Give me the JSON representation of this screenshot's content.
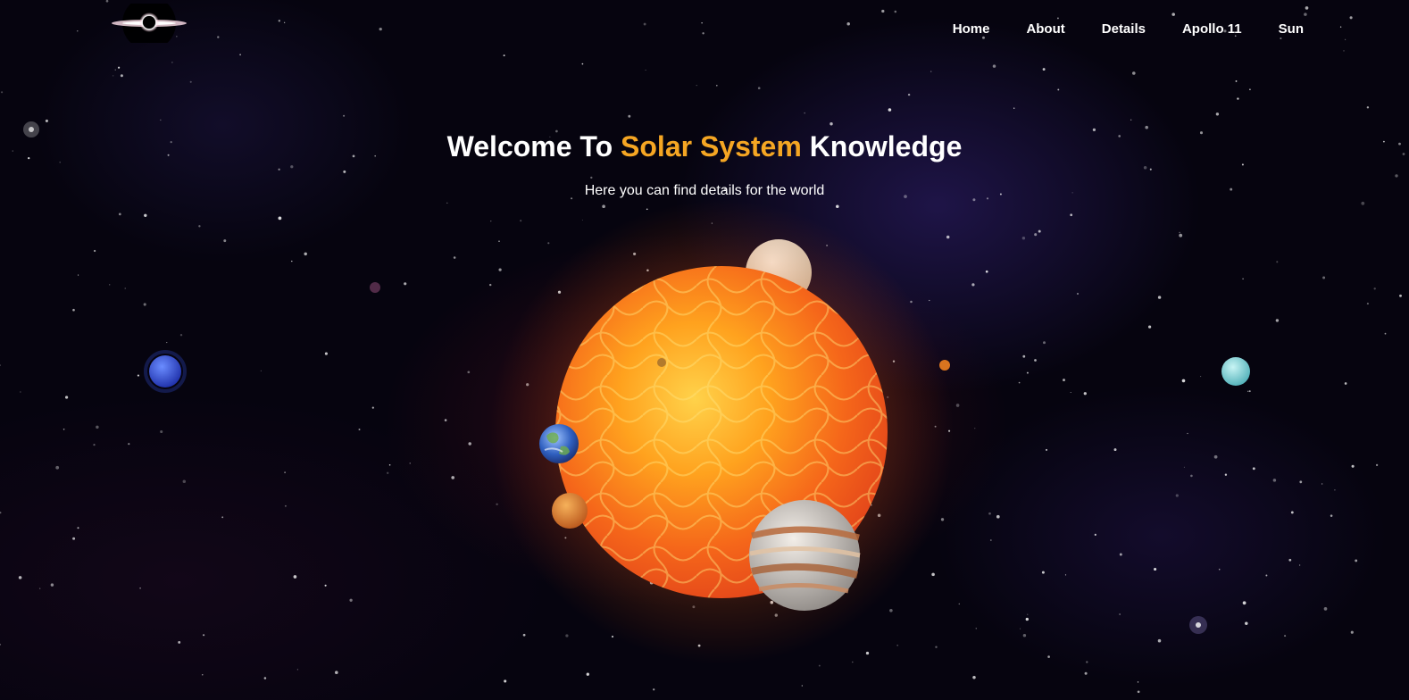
{
  "nav": {
    "logo_icon": "black-hole-logo-icon",
    "links": [
      "Home",
      "About",
      "Details",
      "Apollo 11",
      "Sun"
    ]
  },
  "hero": {
    "title_prefix": "Welcome To ",
    "title_accent": "Solar System",
    "title_suffix": " Knowledge",
    "subtitle": "Here you can find details for the world"
  },
  "colors": {
    "accent": "#f5a623",
    "text": "#ffffff",
    "background": "#06040f"
  },
  "bodies": [
    "sun",
    "jupiter",
    "saturn-like-planet",
    "earth",
    "mars",
    "mercury",
    "venus-small",
    "neptune",
    "uranus"
  ]
}
